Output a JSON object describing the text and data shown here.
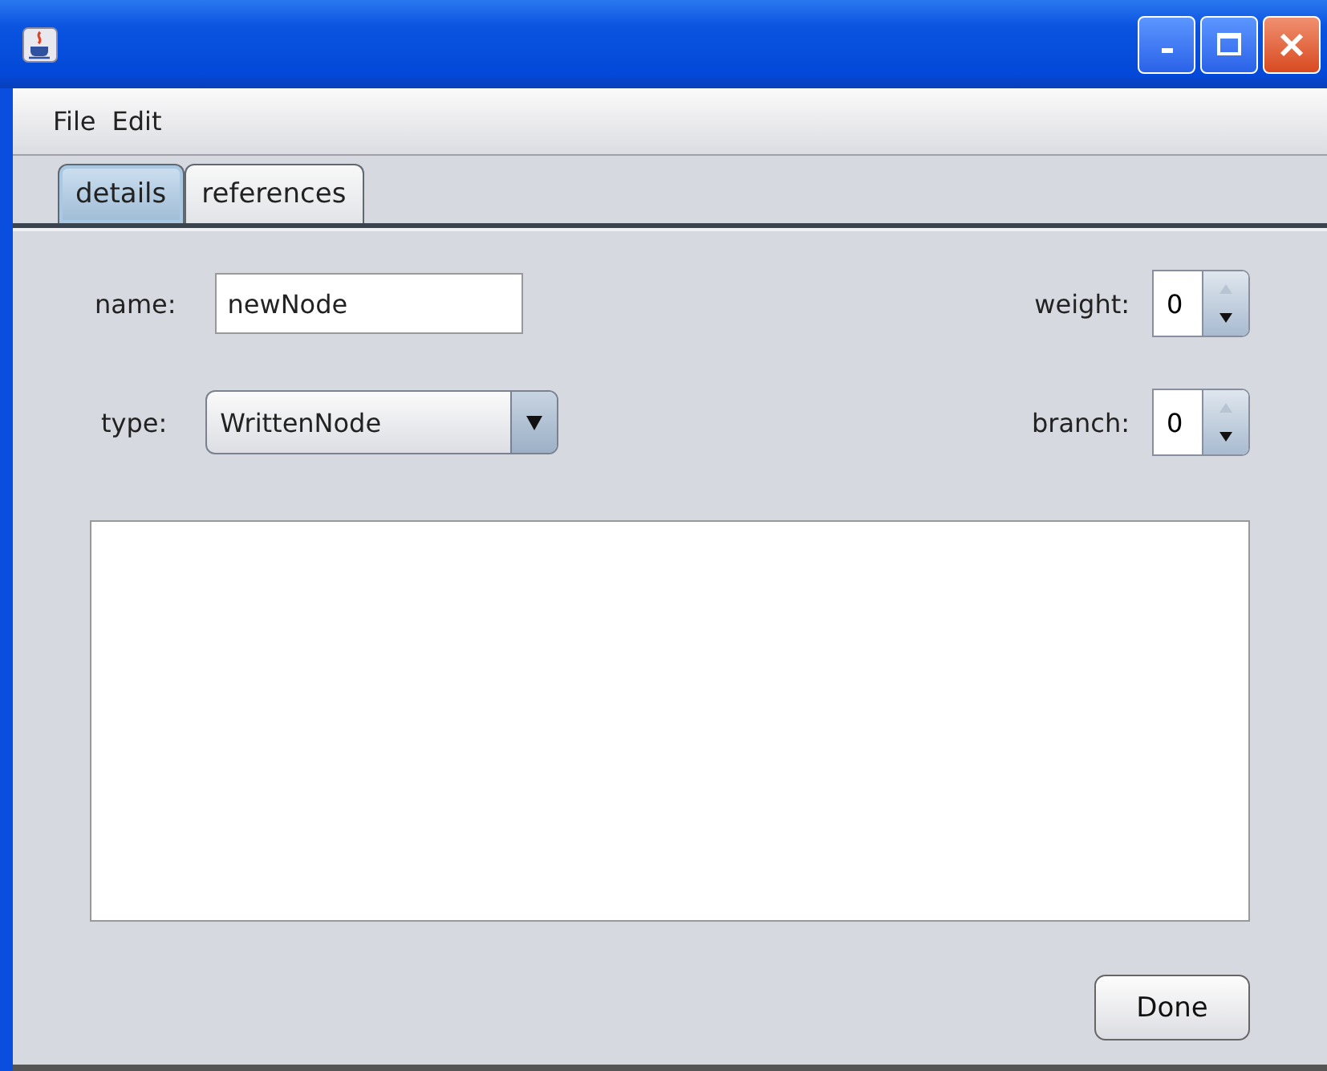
{
  "menu": [
    "File",
    "Edit"
  ],
  "tabs": [
    {
      "label": "details",
      "selected": true
    },
    {
      "label": "references",
      "selected": false
    }
  ],
  "form": {
    "name_label": "name:",
    "name_value": "newNode",
    "type_label": "type:",
    "type_value": "WrittenNode",
    "weight_label": "weight:",
    "weight_value": "0",
    "branch_label": "branch:",
    "branch_value": "0"
  },
  "buttons": [
    "Done"
  ]
}
